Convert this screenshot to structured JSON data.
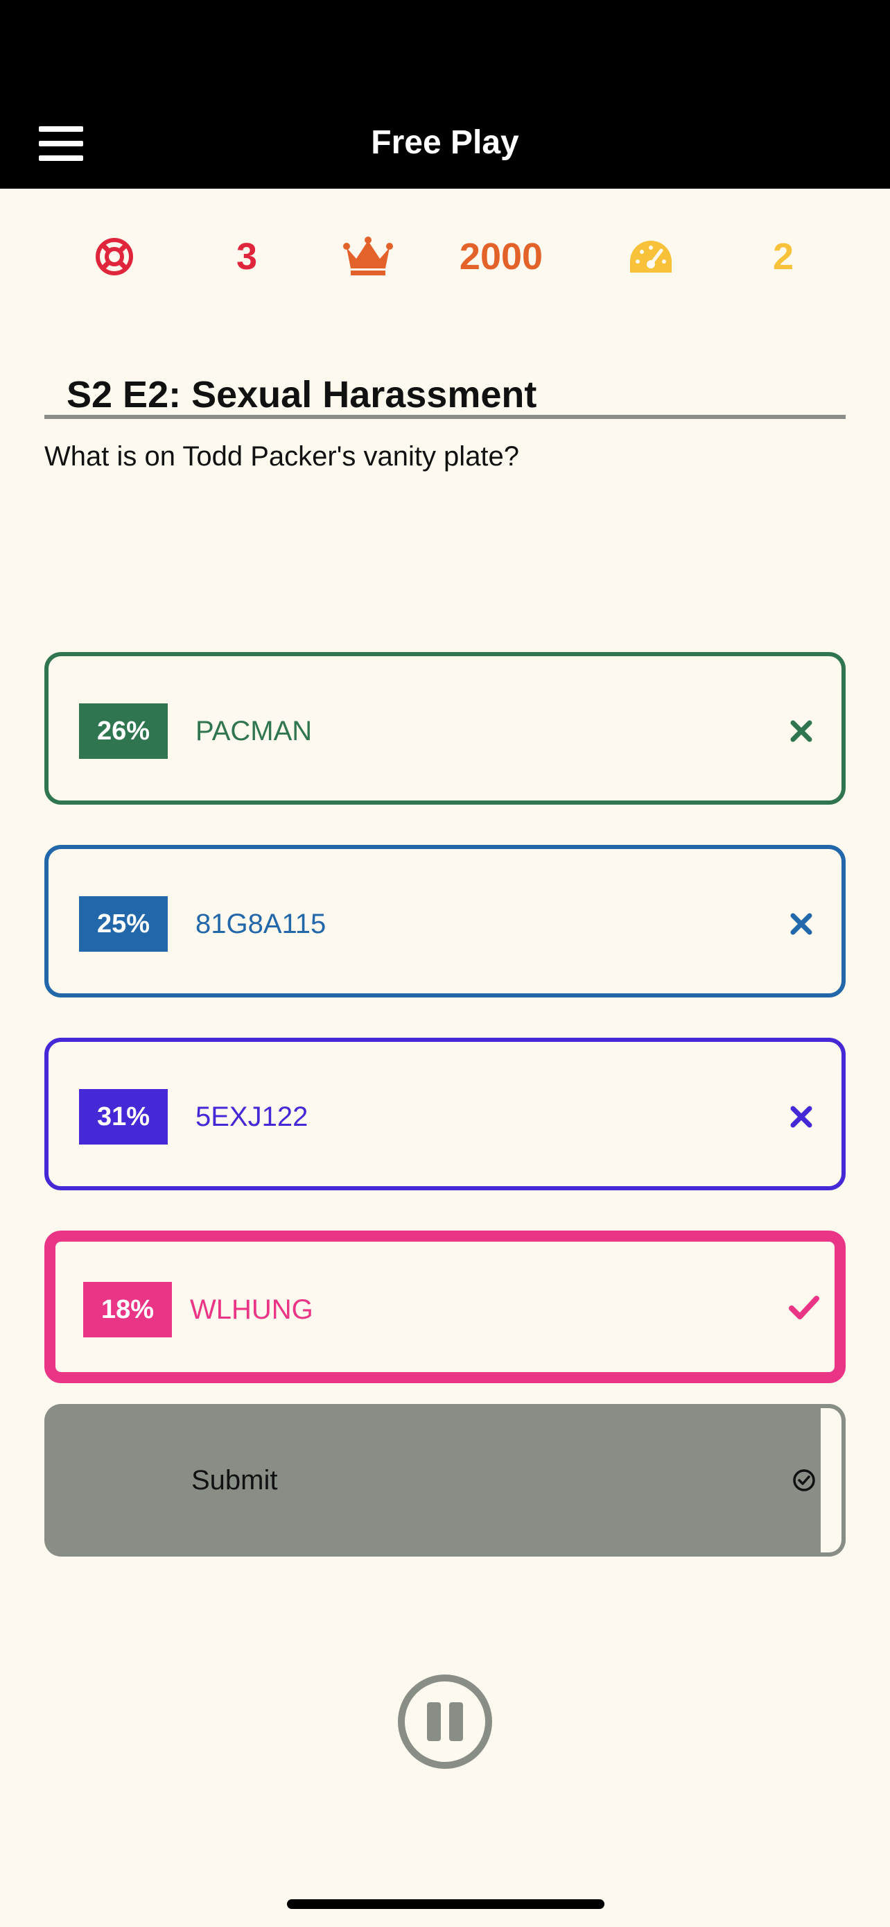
{
  "header": {
    "title": "Free Play",
    "menu_icon": "hamburger-menu-icon"
  },
  "stats": {
    "lifelines": {
      "icon": "lifebuoy-icon",
      "value": "3",
      "color": "#E0263C"
    },
    "score": {
      "icon": "crown-icon",
      "value": "2000",
      "color": "#E3622A"
    },
    "difficulty": {
      "icon": "speedometer-icon",
      "value": "2",
      "color": "#F7C23A"
    }
  },
  "episode": {
    "title": "S2 E2: Sexual Harassment",
    "question": "What is on Todd Packer's vanity plate?"
  },
  "answers": [
    {
      "percent": "26%",
      "text": "PACMAN",
      "mark": "x-icon",
      "color": "#2F7550"
    },
    {
      "percent": "25%",
      "text": "81G8A115",
      "mark": "x-icon",
      "color": "#2167AA"
    },
    {
      "percent": "31%",
      "text": "5EXJ122",
      "mark": "x-icon",
      "color": "#4629D6"
    },
    {
      "percent": "18%",
      "text": "WLHUNG",
      "mark": "check-icon",
      "color": "#EA3586",
      "selected": true
    }
  ],
  "submit": {
    "label": "Submit",
    "icon": "check-circle-icon"
  },
  "controls": {
    "pause_icon": "pause-icon"
  }
}
